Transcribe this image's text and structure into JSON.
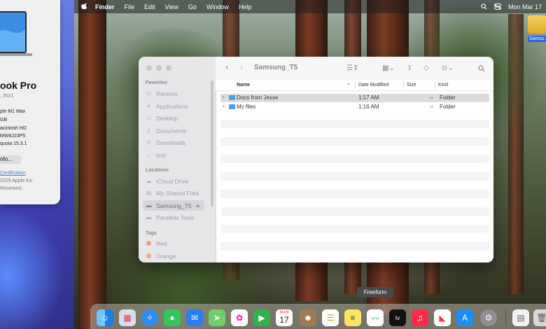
{
  "menubar": {
    "app": "Finder",
    "items": [
      "File",
      "Edit",
      "View",
      "Go",
      "Window",
      "Help"
    ],
    "clock": "Mon Mar 17"
  },
  "about": {
    "title": "ook Pro",
    "year": ", 2021",
    "chip": "ple M1 Max",
    "memory": "GB",
    "disk": "acintosh HD",
    "serial": "MW8J23P5",
    "os": "quoia 15.3.1",
    "info_button": "nfo...",
    "link": "Certification",
    "copyright_1": "2025 Apple Inc.",
    "copyright_2": "Reserved."
  },
  "desktop": {
    "drive_label": "Samsu"
  },
  "finder": {
    "title": "Samsung_T5",
    "sidebar": {
      "favorites_header": "Favorites",
      "favorites": [
        "Recents",
        "Applications",
        "Desktop",
        "Documents",
        "Downloads",
        "test"
      ],
      "locations_header": "Locations",
      "locations": [
        "iCloud Drive",
        "My Shared Files",
        "Samsung_T5",
        "Parallels Tools"
      ],
      "tags_header": "Tags",
      "tags": [
        "Red",
        "Orange"
      ]
    },
    "columns": {
      "name": "Name",
      "date": "Date Modified",
      "size": "Size",
      "kind": "Kind"
    },
    "rows": [
      {
        "name": "Docs from Jesse",
        "date": "1:17 AM",
        "size": "--",
        "kind": "Folder"
      },
      {
        "name": "My files",
        "date": "1:16 AM",
        "size": "--",
        "kind": "Folder"
      }
    ]
  },
  "dock": {
    "tooltip": "Freeform",
    "calendar_month": "MAR",
    "calendar_day": "17",
    "tv_label": "tv"
  },
  "colors": {
    "accent": "#2f64d6",
    "folder": "#4aa0e8"
  }
}
